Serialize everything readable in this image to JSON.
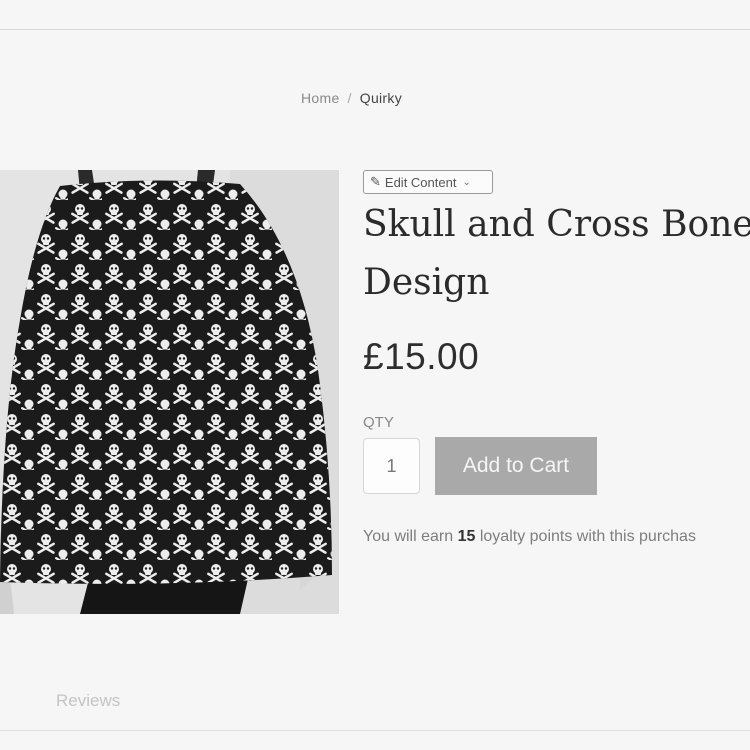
{
  "breadcrumb": {
    "home": "Home",
    "separator": "/",
    "current": "Quirky"
  },
  "admin": {
    "edit_label": "Edit Content",
    "edit_icon": "pencil-icon",
    "chevron_icon": "chevron-down-icon"
  },
  "product": {
    "title_line1": "Skull and Cross Bones",
    "title_line2": "Design",
    "price": "£15.00",
    "image_alt": "skull-and-cross-bones-skirt-photo"
  },
  "purchase": {
    "qty_label": "QTY",
    "qty_value": "1",
    "add_to_cart": "Add to Cart"
  },
  "loyalty": {
    "prefix": "You will earn",
    "points": "15",
    "suffix": "loyalty points with this purchas"
  },
  "tabs": {
    "reviews": "Reviews"
  },
  "colors": {
    "background": "#f6f6f6",
    "button": "#a9a9a9",
    "skirt": "#1b1b1b"
  }
}
